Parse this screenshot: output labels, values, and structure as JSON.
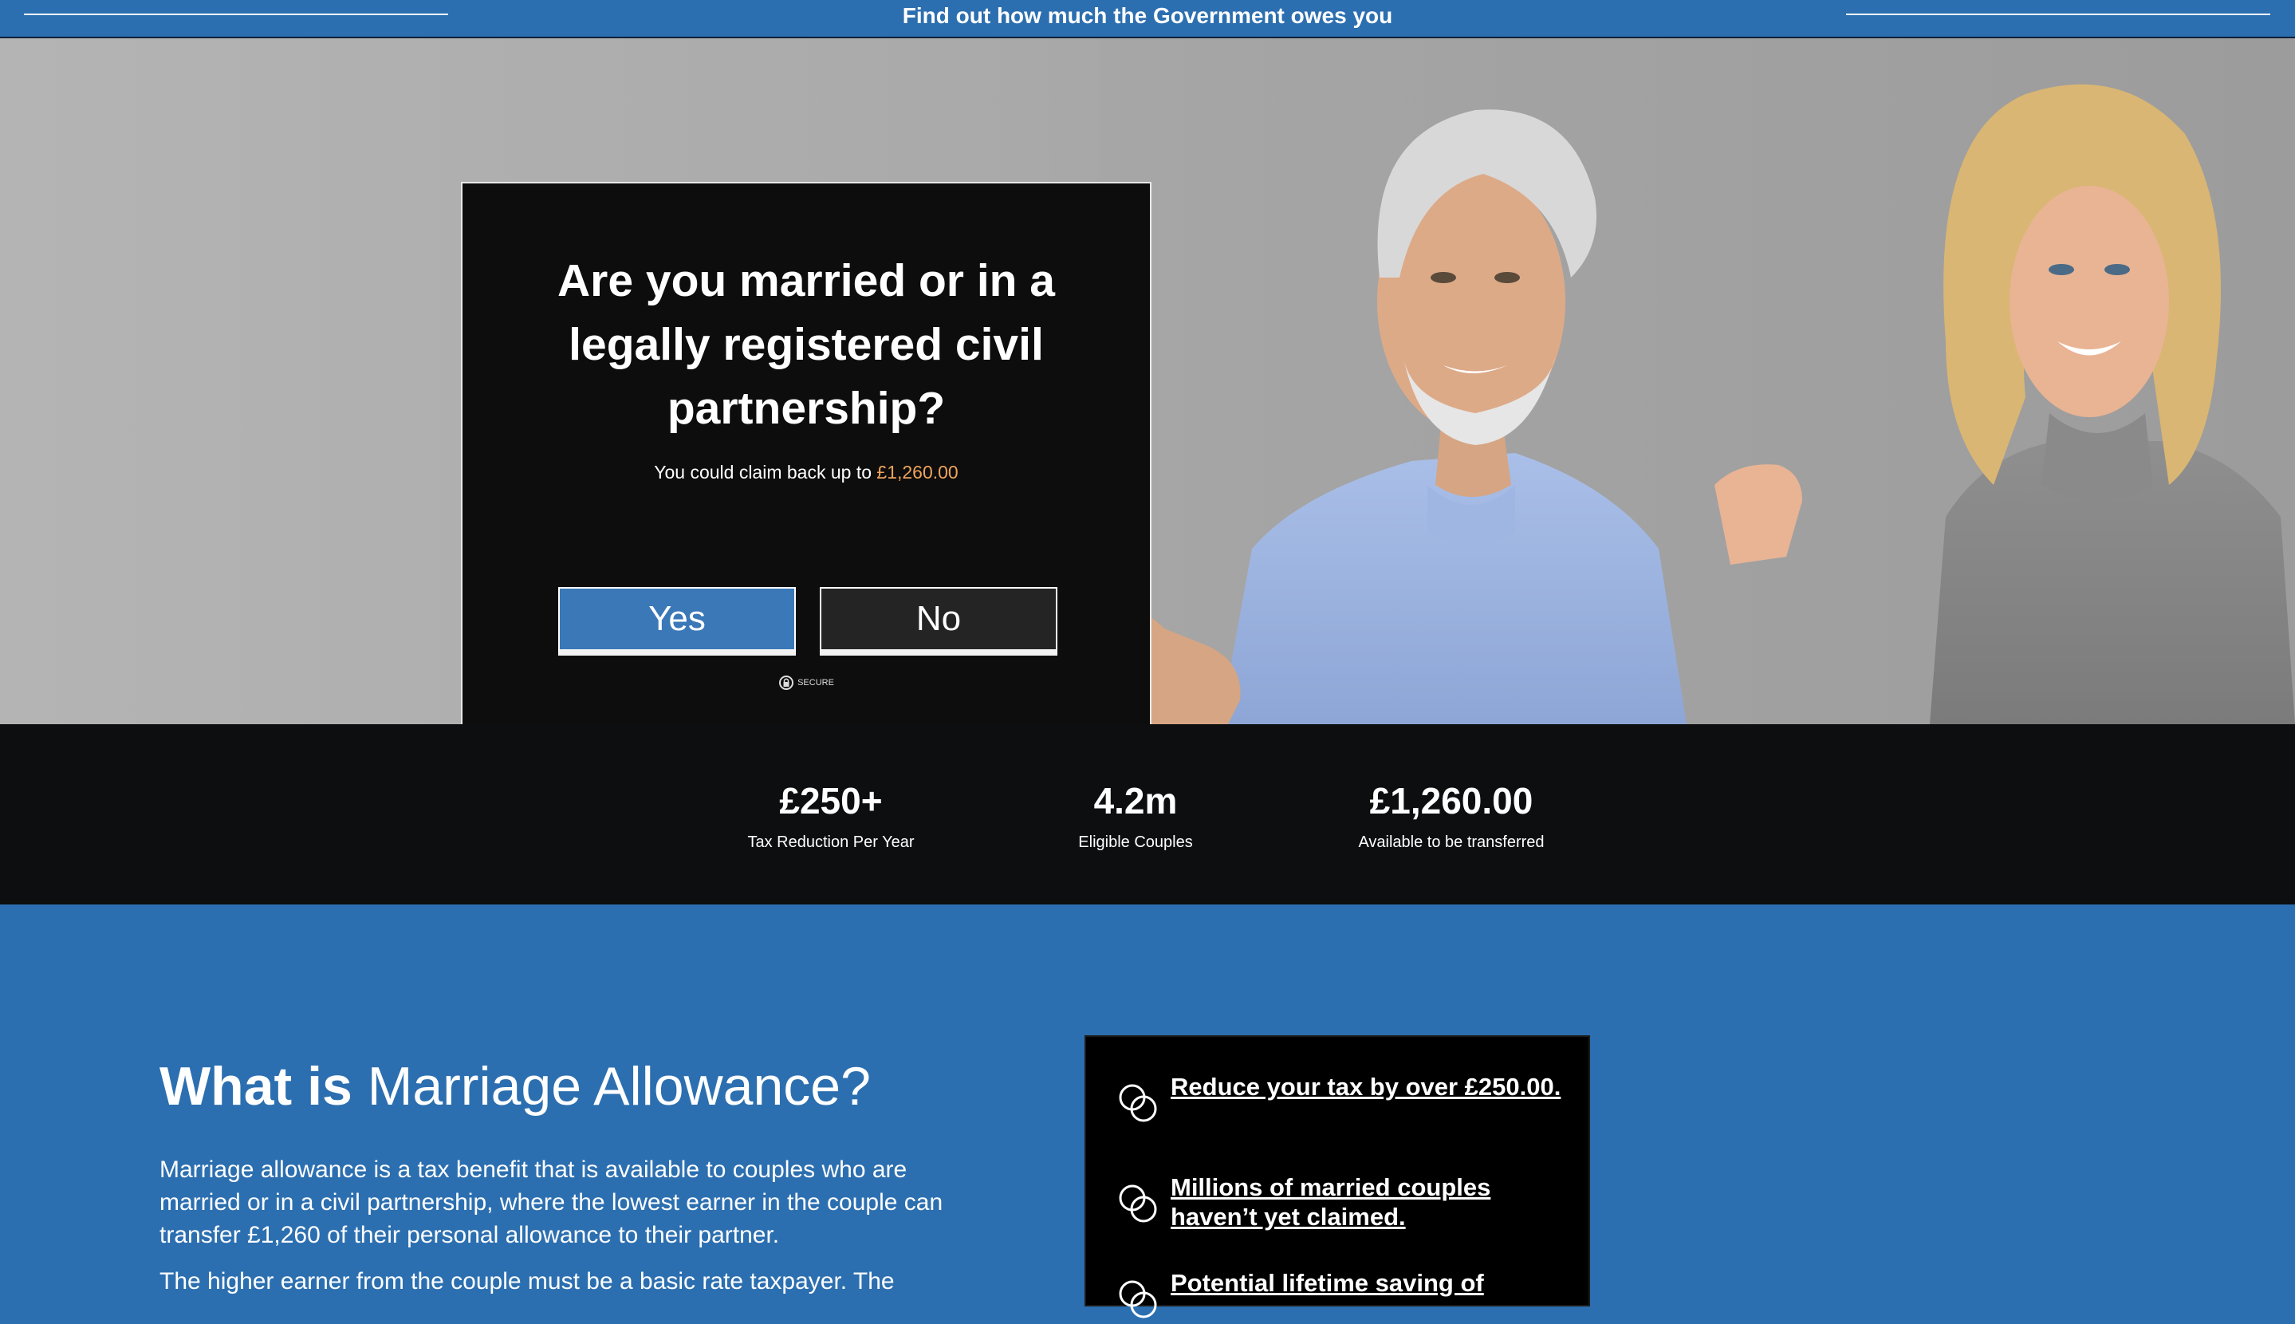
{
  "banner": {
    "headline": "Find out how much the Government owes you"
  },
  "hero": {
    "question": "Are you married or in a legally registered civil partnership?",
    "claim_prefix": "You could claim back up to",
    "claim_amount": "£1,260.00",
    "yes_label": "Yes",
    "no_label": "No",
    "secure_label": "SECURE"
  },
  "stats": [
    {
      "value": "£250+",
      "label": "Tax Reduction Per Year"
    },
    {
      "value": "4.2m",
      "label": "Eligible Couples"
    },
    {
      "value": "£1,260.00",
      "label": "Available to be transferred"
    }
  ],
  "info": {
    "title_strong": "What is",
    "title_rest": "Marriage Allowance?",
    "paragraphs": [
      "Marriage allowance is a tax benefit that is available to couples who are married or in a civil partnership, where the lowest earner in the couple can transfer £1,260 of their personal allowance to their partner.",
      "The higher earner from the couple must be a basic rate taxpayer. The"
    ]
  },
  "benefits": [
    {
      "text": "Reduce your tax by over £250.00.",
      "icon": "rings-icon"
    },
    {
      "text": "Millions of married couples haven’t yet claimed.",
      "icon": "rings-icon"
    },
    {
      "text": "Potential lifetime saving of",
      "icon": "rings-icon"
    }
  ],
  "colors": {
    "brand_blue": "#2c6fb0",
    "card_black": "#0d0d0d",
    "accent_orange": "#f0a35b",
    "yes_button": "#3a78b8",
    "no_button": "#242424"
  }
}
